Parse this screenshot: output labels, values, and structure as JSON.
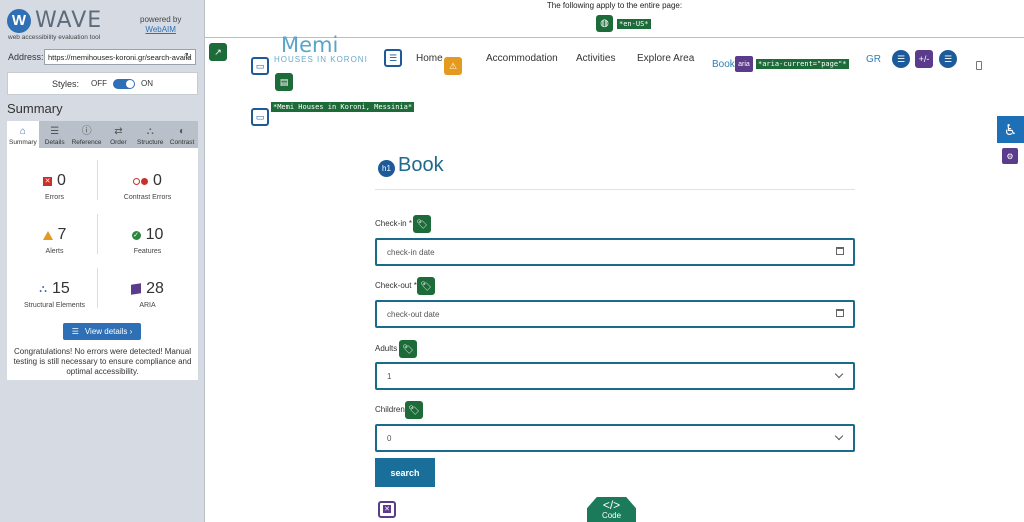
{
  "wave": {
    "logo_letter": "W",
    "logo_text": "WAVE",
    "tagline": "web accessibility evaluation tool",
    "powered_by": "powered by",
    "webaim": "WebAIM",
    "address_label": "Address:",
    "address_value": "https://memihouses-koroni.gr/search-availa",
    "styles_label": "Styles:",
    "styles_off": "OFF",
    "styles_on": "ON",
    "summary_title": "Summary",
    "tabs": [
      {
        "label": "Summary",
        "icon": "home-icon"
      },
      {
        "label": "Details",
        "icon": "list-icon"
      },
      {
        "label": "Reference",
        "icon": "info-icon"
      },
      {
        "label": "Order",
        "icon": "order-icon"
      },
      {
        "label": "Structure",
        "icon": "structure-icon"
      },
      {
        "label": "Contrast",
        "icon": "contrast-icon"
      }
    ],
    "stats": {
      "errors": {
        "value": "0",
        "label": "Errors"
      },
      "contrast": {
        "value": "0",
        "label": "Contrast Errors"
      },
      "alerts": {
        "value": "7",
        "label": "Alerts"
      },
      "features": {
        "value": "10",
        "label": "Features"
      },
      "structural": {
        "value": "15",
        "label": "Structural Elements"
      },
      "aria": {
        "value": "28",
        "label": "ARIA"
      }
    },
    "view_details": "View details ›",
    "congrats": "Congratulations! No errors were detected! Manual testing is still necessary to ensure compliance and optimal accessibility."
  },
  "page": {
    "notice": "The following apply to the entire page:",
    "lang_tag": "*en-US*",
    "logo_text": "Memi",
    "logo_sub": "HOUSES IN KORONI",
    "logo_alt_tag": "*Memi Houses in Koroni, Messinia*",
    "nav": {
      "home": "Home",
      "accommodation": "Accommodation",
      "activities": "Activities",
      "explore": "Explore Area",
      "book": "Book",
      "aria_chip": "aria",
      "aria_current": "*aria-current=\"page\"*",
      "gr": "GR"
    },
    "h1_badge": "h1",
    "title": "Book",
    "form": {
      "checkin_label": "Check-in",
      "checkin_placeholder": "check-in date",
      "checkout_label": "Check-out",
      "checkout_placeholder": "check-out date",
      "required_mark": "*",
      "adults_label": "Adults",
      "adults_value": "1",
      "children_label": "Children",
      "children_value": "0",
      "search": "search"
    },
    "code_tab": "Code",
    "code_symbol": "</>"
  },
  "colors": {
    "wave_blue": "#2f6fb5",
    "wave_green": "#1e6b3a",
    "aria_purple": "#5b3b8c",
    "field_border": "#1a6a8c",
    "search_button": "#1a6f9a"
  }
}
